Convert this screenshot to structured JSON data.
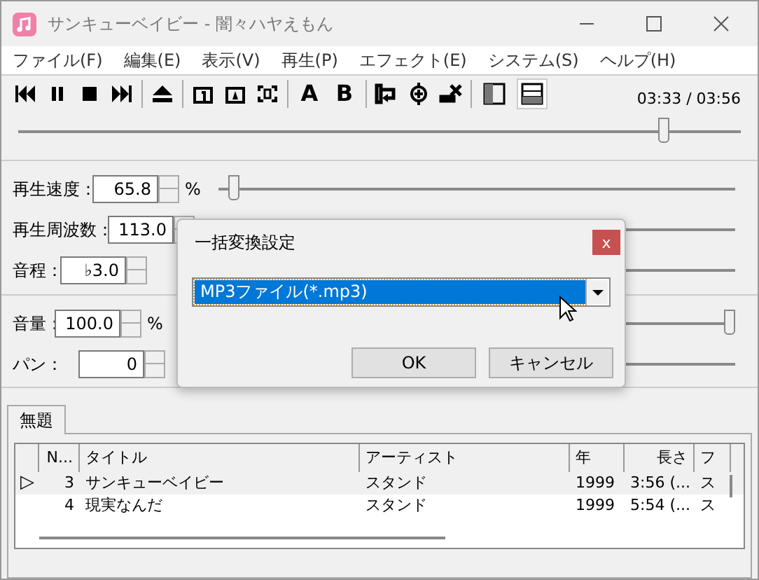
{
  "window": {
    "title": "サンキューベイビー - 闇々ハヤえもん"
  },
  "menu": [
    "ファイル(F)",
    "編集(E)",
    "表示(V)",
    "再生(P)",
    "エフェクト(E)",
    "システム(S)",
    "ヘルプ(H)"
  ],
  "toolbar": {
    "labels": [
      "A",
      "B"
    ],
    "view_buttons": [
      {
        "selected": false
      },
      {
        "selected": true
      }
    ],
    "time": "03:33 / 03:56"
  },
  "seek": {
    "level": 0.9
  },
  "controls": [
    {
      "label": "再生速度：",
      "value": "65.8",
      "unit": "%",
      "level": 0.02
    },
    {
      "label": "再生周波数：",
      "value": "113.0"
    },
    {
      "label": "音程：",
      "value": "♭3.0"
    }
  ],
  "controls2": [
    {
      "label": "音量：",
      "value": "100.0",
      "unit": "%",
      "level": 1
    },
    {
      "label": "パン：",
      "value": "0"
    }
  ],
  "dialog": {
    "title": "一括変換設定",
    "close": "x",
    "select": {
      "value": "MP3ファイル(*.mp3)"
    },
    "buttons": [
      "OK",
      "キャンセル"
    ]
  },
  "tabs": [
    {
      "label": "無題",
      "selected": true
    }
  ],
  "table": {
    "columns": [
      "N...",
      "タイトル",
      "アーティスト",
      "年",
      "長さ",
      "フ"
    ],
    "rows": [
      {
        "playing": true,
        "marker": "▷",
        "cells": [
          "3",
          "サンキューベイビー",
          "スタンド",
          "1999",
          "3:56 (...",
          "ス"
        ]
      },
      {
        "playing": false,
        "marker": "",
        "cells": [
          "4",
          "現実なんだ",
          "スタンド",
          "1999",
          "5:54 (...",
          "ス"
        ]
      }
    ]
  }
}
